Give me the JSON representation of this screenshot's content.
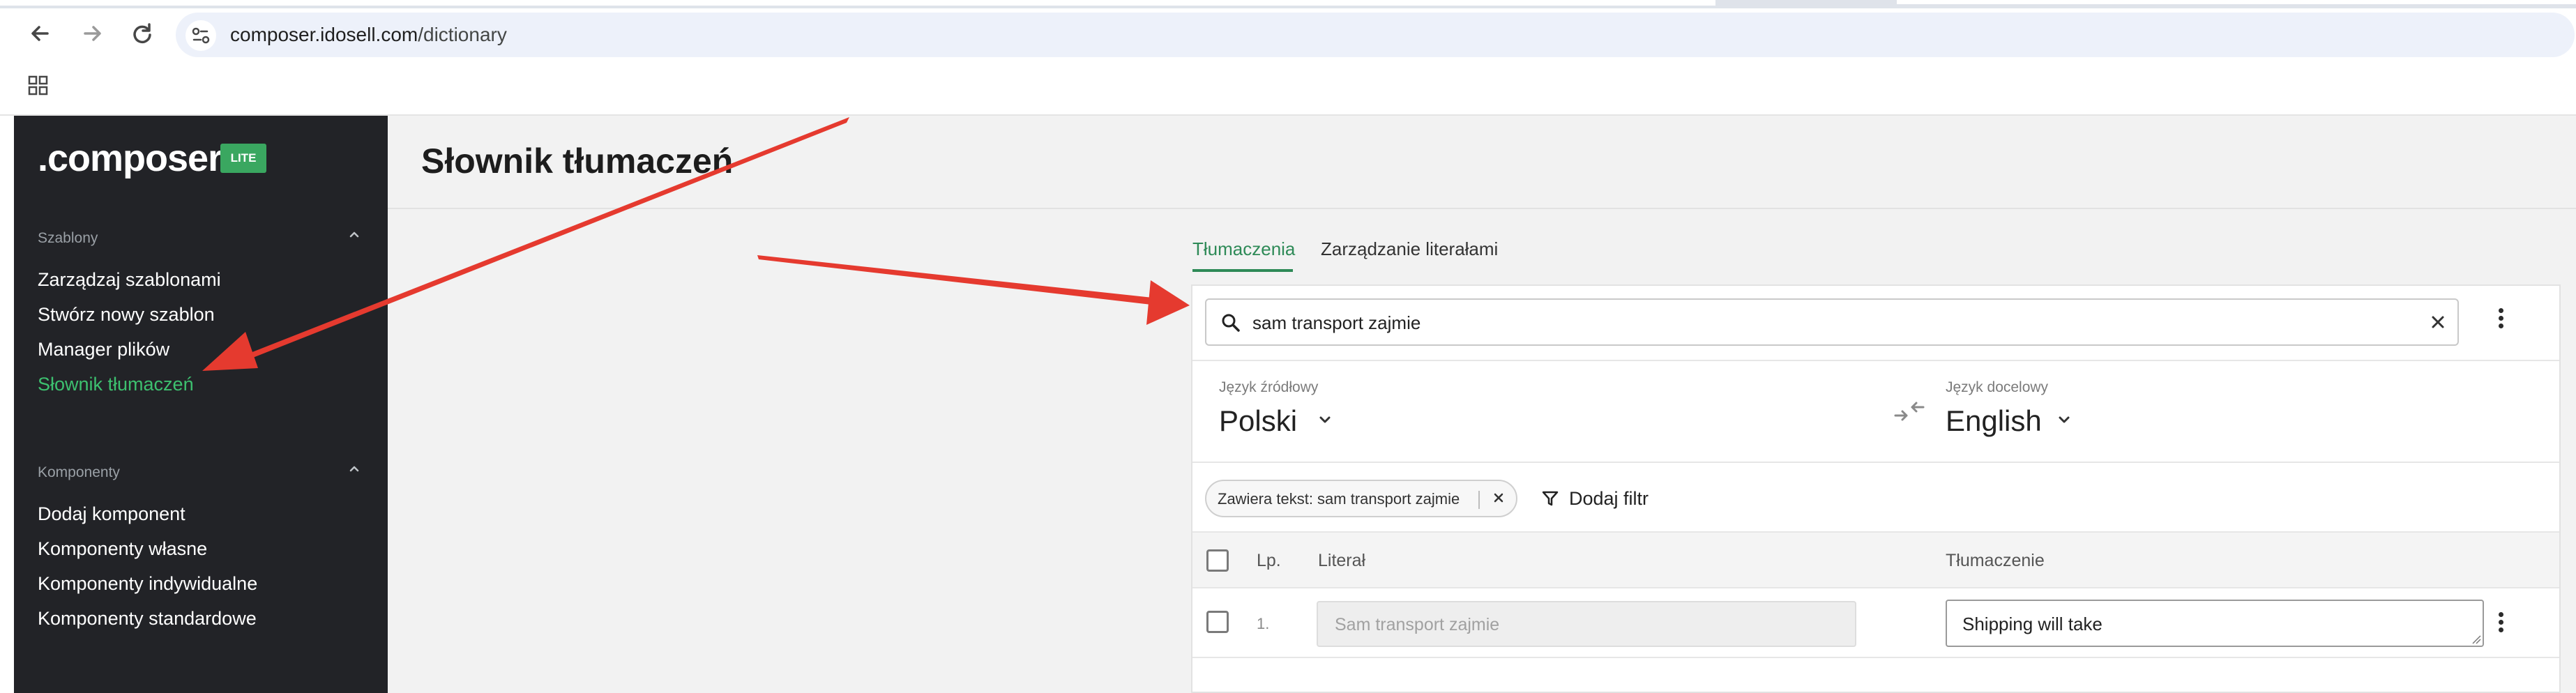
{
  "browser": {
    "url_host": "composer.idosell.com",
    "url_path": "/dictionary",
    "icons": [
      "back-icon",
      "forward-icon",
      "reload-icon",
      "site-info-icon",
      "apps-icon"
    ]
  },
  "sidebar": {
    "logo": ".composer",
    "badge": "LITE",
    "sections": [
      {
        "title": "Szablony",
        "items": [
          {
            "label": "Zarządzaj szablonami",
            "active": false
          },
          {
            "label": "Stwórz nowy szablon",
            "active": false
          },
          {
            "label": "Manager plików",
            "active": false
          },
          {
            "label": "Słownik tłumaczeń",
            "active": true
          }
        ]
      },
      {
        "title": "Komponenty",
        "items": [
          {
            "label": "Dodaj komponent",
            "active": false
          },
          {
            "label": "Komponenty własne",
            "active": false
          },
          {
            "label": "Komponenty indywidualne",
            "active": false
          },
          {
            "label": "Komponenty standardowe",
            "active": false
          }
        ]
      }
    ]
  },
  "main": {
    "title": "Słownik tłumaczeń",
    "tabs": [
      {
        "label": "Tłumaczenia",
        "active": true
      },
      {
        "label": "Zarządzanie literałami",
        "active": false
      }
    ],
    "search": {
      "value": "sam transport zajmie"
    },
    "source_lang": {
      "label": "Język źródłowy",
      "value": "Polski"
    },
    "target_lang": {
      "label": "Język docelowy",
      "value": "English"
    },
    "filter_chip": "Zawiera tekst: sam transport zajmie",
    "add_filter": "Dodaj filtr",
    "table": {
      "columns": [
        "Lp.",
        "Literał",
        "Tłumaczenie"
      ],
      "rows": [
        {
          "num": "1.",
          "literal": "Sam transport zajmie",
          "translation": "Shipping will take"
        }
      ]
    }
  },
  "colors": {
    "sidebar_bg": "#222327",
    "accent_green": "#2e8a57",
    "active_nav": "#3dc06f",
    "badge": "#3aa760",
    "annotation_arrow": "#e53a2f"
  }
}
